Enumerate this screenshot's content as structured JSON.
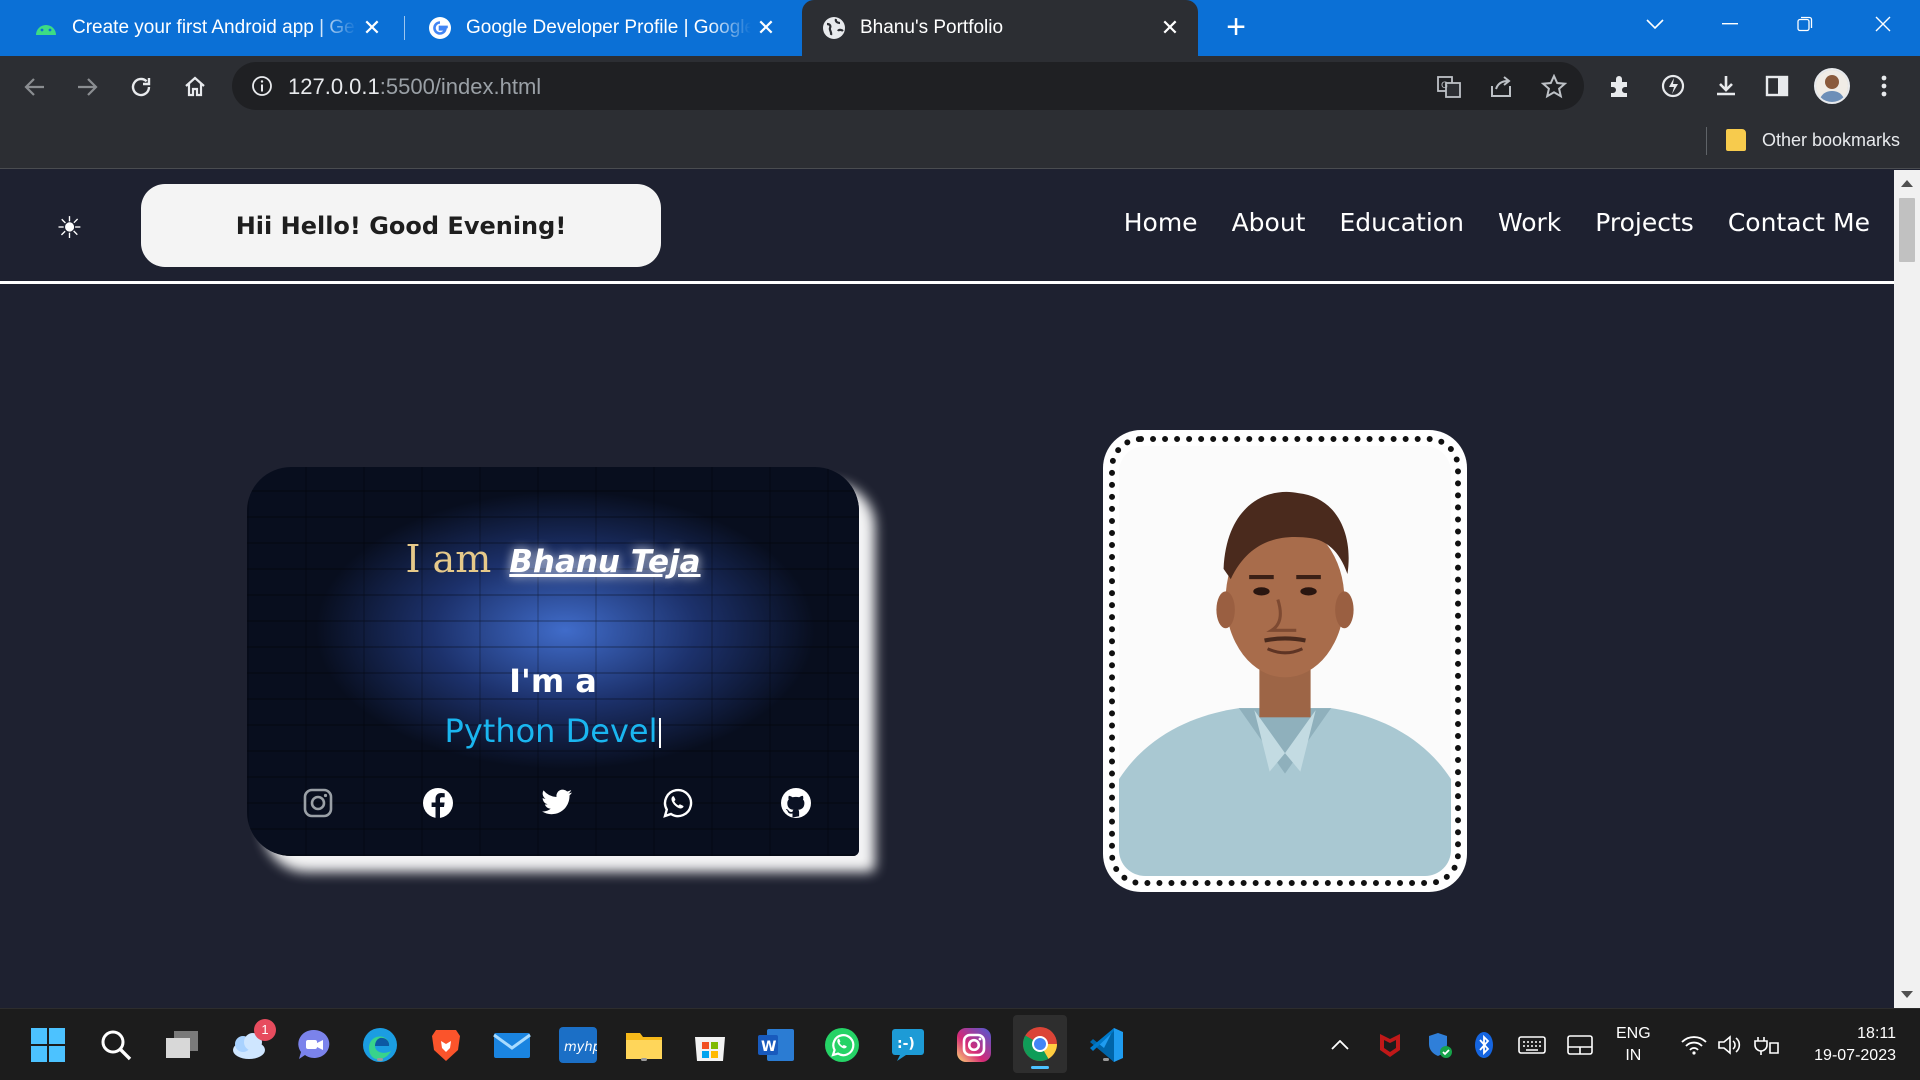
{
  "browser": {
    "tabs": [
      {
        "title": "Create your first Android app  |  Get started",
        "icon": "android-icon",
        "active": false
      },
      {
        "title": "Google Developer Profile  |  Google Developers",
        "icon": "google-icon",
        "active": false
      },
      {
        "title": "Bhanu's Portfolio",
        "icon": "globe-icon",
        "active": true
      }
    ],
    "url_host": "127.0.0.1",
    "url_path": ":5500/index.html",
    "bookmarks_label": "Other bookmarks"
  },
  "site": {
    "greeting": "Hii Hello! Good Evening!",
    "theme_icon": "sun-icon",
    "nav": [
      "Home",
      "About",
      "Education",
      "Work",
      "Projects",
      "Contact Me"
    ],
    "hero": {
      "iam_prefix": "I am",
      "name": "Bhanu Teja",
      "ima": "I'm a",
      "role_typed": "Python Devel",
      "socials": [
        "instagram-icon",
        "facebook-icon",
        "twitter-icon",
        "whatsapp-icon",
        "github-icon"
      ]
    }
  },
  "taskbar": {
    "notification_badge": "1",
    "lang_top": "ENG",
    "lang_bottom": "IN",
    "time": "18:11",
    "date": "19-07-2023"
  },
  "colors": {
    "tabstrip": "#0b70d6",
    "toolbar": "#2c2e33",
    "page_bg": "#1e2130",
    "role_text": "#1ab6f0",
    "iam_prefix": "#e6c98a"
  }
}
